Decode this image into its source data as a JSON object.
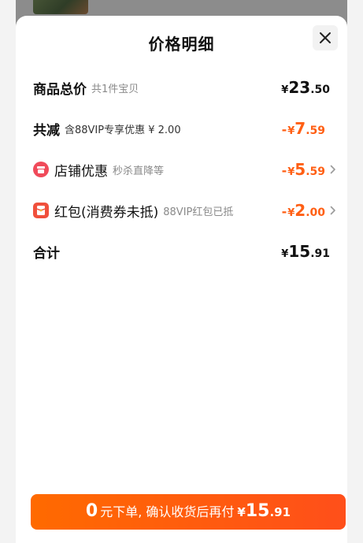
{
  "header": {
    "title": "价格明细"
  },
  "rows": {
    "total_goods": {
      "label": "商品总价",
      "note": "共1件宝贝",
      "currency": "¥",
      "int": "23",
      "dec": ".50"
    },
    "total_discount": {
      "label": "共减",
      "note": "含88VIP专享优惠 ¥ 2.00",
      "minus": "-",
      "currency": "¥",
      "int": "7",
      "dec": ".59"
    },
    "shop_discount": {
      "label": "店铺优惠",
      "note": "秒杀直降等",
      "minus": "-",
      "currency": "¥",
      "int": "5",
      "dec": ".59"
    },
    "red_packet": {
      "label": "红包(消费券未抵)",
      "note": "88VIP红包已抵",
      "minus": "-",
      "currency": "¥",
      "int": "2",
      "dec": ".00"
    },
    "grand_total": {
      "label": "合计",
      "currency": "¥",
      "int": "15",
      "dec": ".91"
    }
  },
  "confirm": {
    "zero": "0",
    "text": "元下单, 确认收货后再付",
    "currency": "¥",
    "int": "15",
    "dec": ".91"
  },
  "icons": {
    "close": "close-icon",
    "shop": "shop-icon",
    "red_packet": "red-packet-icon",
    "chevron": "chevron-right-icon"
  },
  "colors": {
    "accent": "#ff5f14",
    "button_start": "#ff6a00",
    "button_end": "#ff4f1a",
    "shop_icon": "#f04a5a",
    "red_packet_icon": "#f0503c"
  }
}
